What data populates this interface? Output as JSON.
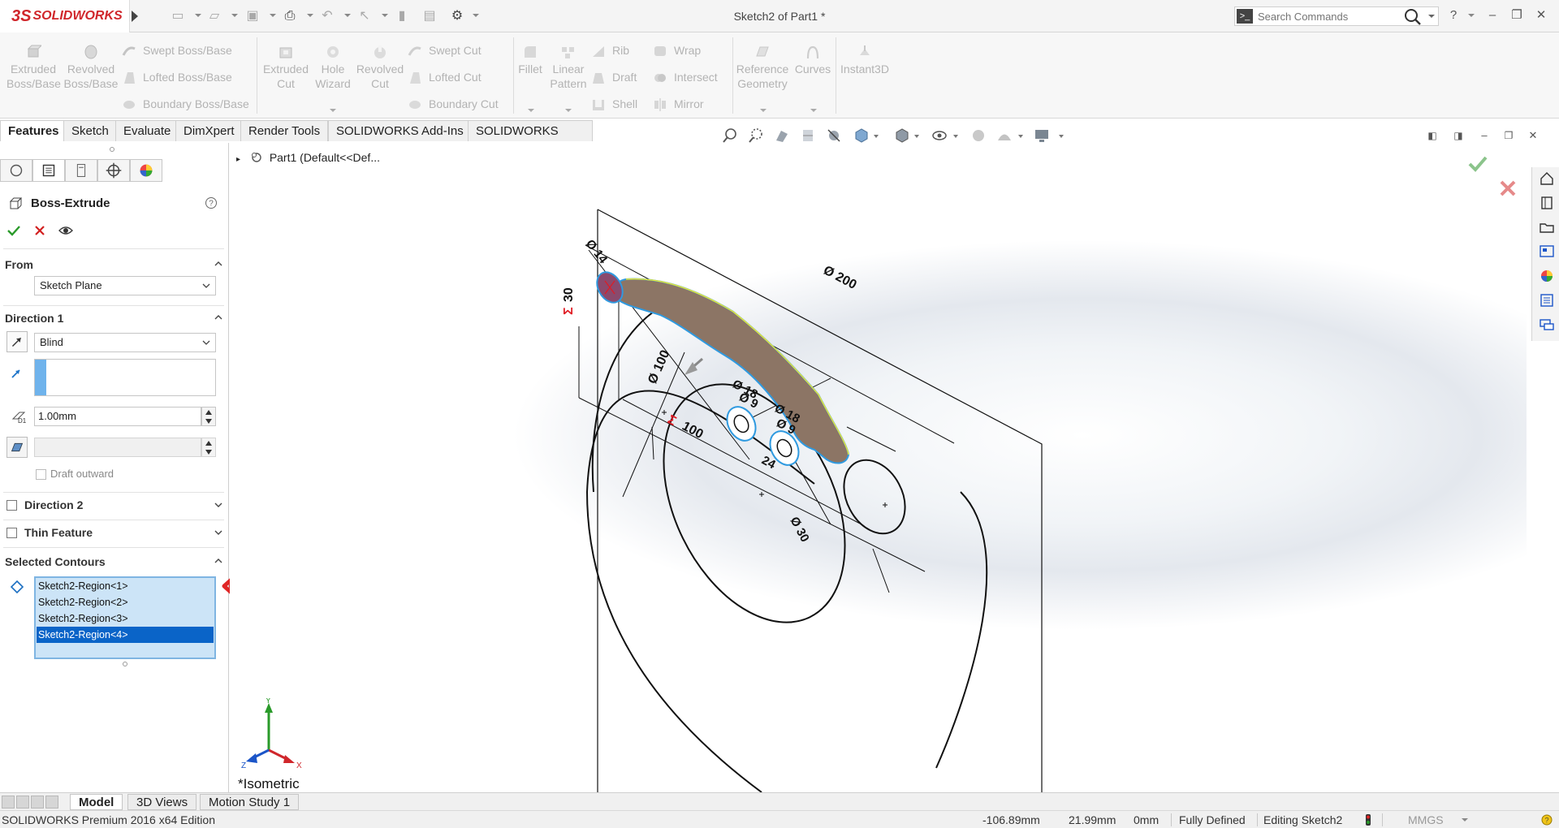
{
  "app": {
    "brand_ds": "3S",
    "brand_name": "SOLIDWORKS",
    "document_title": "Sketch2 of Part1 *",
    "search_placeholder": "Search Commands",
    "help_glyph": "?"
  },
  "command_manager": {
    "extruded_boss": [
      "Extruded",
      "Boss/Base"
    ],
    "revolved_boss": [
      "Revolved",
      "Boss/Base"
    ],
    "swept_boss": "Swept Boss/Base",
    "lofted_boss": "Lofted Boss/Base",
    "boundary_boss": "Boundary Boss/Base",
    "extruded_cut": [
      "Extruded",
      "Cut"
    ],
    "hole_wizard": [
      "Hole",
      "Wizard"
    ],
    "revolved_cut": [
      "Revolved",
      "Cut"
    ],
    "swept_cut": "Swept Cut",
    "lofted_cut": "Lofted Cut",
    "boundary_cut": "Boundary Cut",
    "fillet": "Fillet",
    "linear_pattern": [
      "Linear",
      "Pattern"
    ],
    "rib": "Rib",
    "draft": "Draft",
    "shell": "Shell",
    "wrap": "Wrap",
    "intersect": "Intersect",
    "mirror": "Mirror",
    "reference_geometry": [
      "Reference",
      "Geometry"
    ],
    "curves": "Curves",
    "instant3d": "Instant3D"
  },
  "tabs": [
    "Features",
    "Sketch",
    "Evaluate",
    "DimXpert",
    "Render Tools",
    "SOLIDWORKS Add-Ins",
    "SOLIDWORKS MBD"
  ],
  "property_manager": {
    "title": "Boss-Extrude",
    "from_label": "From",
    "from_value": "Sketch Plane",
    "direction1_label": "Direction 1",
    "end_condition": "Blind",
    "depth_value": "1.00mm",
    "draft_outward_label": "Draft outward",
    "direction2_label": "Direction 2",
    "thin_feature_label": "Thin Feature",
    "selected_contours_label": "Selected Contours",
    "contours": [
      "Sketch2-Region<1>",
      "Sketch2-Region<2>",
      "Sketch2-Region<3>",
      "Sketch2-Region<4>"
    ],
    "selected_contour_index": 3
  },
  "graphics": {
    "tree_item": "Part1  (Default<<Def...",
    "view_name": "*Isometric",
    "triad_labels": {
      "x": "X",
      "y": "Y",
      "z": "Z"
    },
    "dimensions": {
      "d14": "Ø 14",
      "d200": "Ø 200",
      "d30_left": "30",
      "d100_diag": "Ø 100",
      "d100_horiz": "100",
      "d18_a": "Ø 18",
      "d9": "Ø 9",
      "d18_b": "Ø 18",
      "d9_b": "Ø 9",
      "d24": "24",
      "d30_bottom": "Ø 30",
      "sigma": "Σ"
    },
    "colors": {
      "region_fill": "#8c7565",
      "highlight_edge": "#2f9ae0",
      "selected_edge": "#e6e63a",
      "driving_sigma": "#e01b24"
    }
  },
  "bottom_tabs": [
    "Model",
    "3D Views",
    "Motion Study 1"
  ],
  "status": {
    "edition": "SOLIDWORKS Premium 2016 x64 Edition",
    "x": "-106.89mm",
    "y": "21.99mm",
    "z": "0mm",
    "definition": "Fully Defined",
    "editing": "Editing Sketch2",
    "units": "MMGS"
  }
}
